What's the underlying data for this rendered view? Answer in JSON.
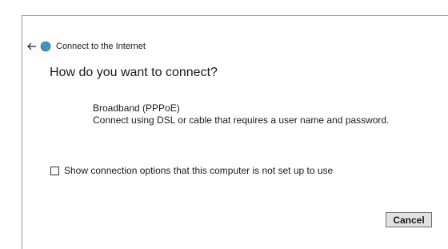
{
  "window": {
    "title": "Connect to the Internet"
  },
  "icons": {
    "back": "back-arrow-icon",
    "app": "network-globe-icon"
  },
  "heading": "How do you want to connect?",
  "options": [
    {
      "title": "Broadband (PPPoE)",
      "description": "Connect using DSL or cable that requires a user name and password."
    }
  ],
  "show_options_checkbox": {
    "label": "Show connection options that this computer is not set up to use",
    "checked": false
  },
  "buttons": {
    "cancel": "Cancel"
  }
}
